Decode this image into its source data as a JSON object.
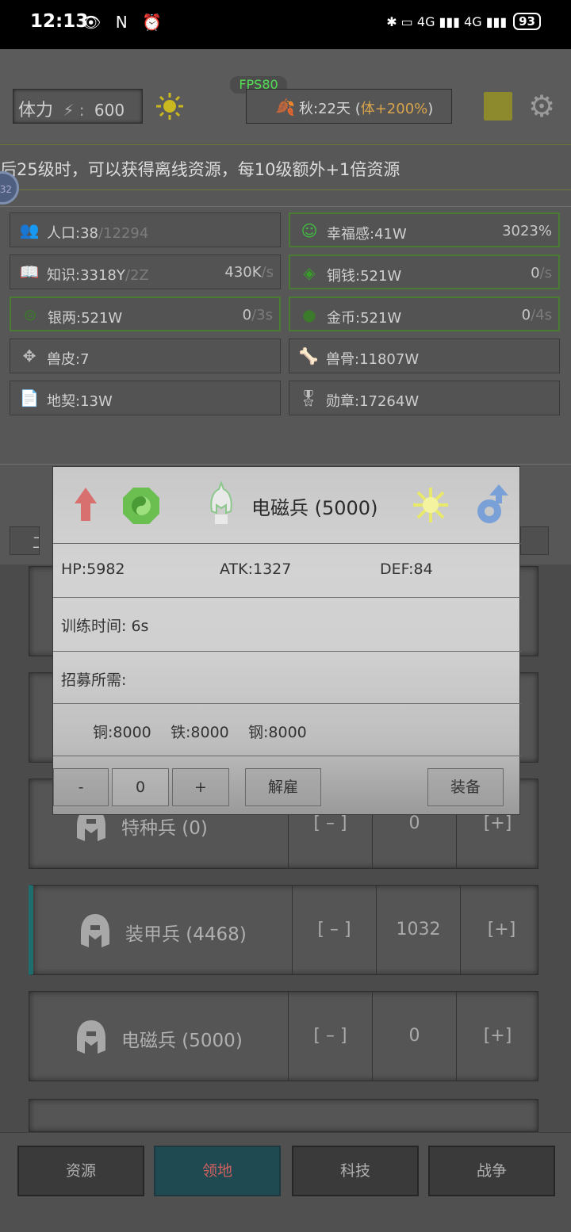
{
  "status_bar": {
    "time": "12:13",
    "icons": "👁 N ⏰",
    "network": "✱ ▭ 4G ▮▮▮ 4G ▮▮▮",
    "battery": "93"
  },
  "top": {
    "stamina_label": "体力",
    "stamina_sep": "⚡ :",
    "stamina_value": "600",
    "fps": "FPS80",
    "season_text": "秋:22天 (",
    "season_bonus": "体+200%",
    "season_close": ")"
  },
  "notice": "后25级时，可以获得离线资源，每10级额外+1倍资源",
  "badge": "32",
  "resources": [
    {
      "icon": "population-icon",
      "glyph": "👥",
      "name": "人口:38",
      "name_dim": "/12294",
      "rate": "",
      "rate_dim": ""
    },
    {
      "icon": "happiness-icon",
      "glyph": "☺",
      "name": "幸福感:41W",
      "name_dim": "",
      "rate": "3023%",
      "rate_dim": ""
    },
    {
      "icon": "knowledge-icon",
      "glyph": "📖",
      "name": "知识:3318Y",
      "name_dim": "/2Z",
      "rate": "430K",
      "rate_dim": "/s"
    },
    {
      "icon": "copper-coin-icon",
      "glyph": "◈",
      "name": "铜钱:521W",
      "name_dim": "",
      "rate": "0",
      "rate_dim": "/s"
    },
    {
      "icon": "silver-icon",
      "glyph": "⊜",
      "name": "银两:521W",
      "name_dim": "",
      "rate": "0",
      "rate_dim": "/3s"
    },
    {
      "icon": "gold-coin-icon",
      "glyph": "●",
      "name": "金币:521W",
      "name_dim": "",
      "rate": "0",
      "rate_dim": "/4s"
    },
    {
      "icon": "beast-hide-icon",
      "glyph": "✥",
      "name": "兽皮:7",
      "name_dim": "",
      "rate": "",
      "rate_dim": ""
    },
    {
      "icon": "beast-bone-icon",
      "glyph": "🦴",
      "name": "兽骨:11807W",
      "name_dim": "",
      "rate": "",
      "rate_dim": ""
    },
    {
      "icon": "land-deed-icon",
      "glyph": "📄",
      "name": "地契:13W",
      "name_dim": "",
      "rate": "",
      "rate_dim": ""
    },
    {
      "icon": "medal-icon",
      "glyph": "🎖",
      "name": "勋章:17264W",
      "name_dim": "",
      "rate": "",
      "rate_dim": ""
    }
  ],
  "tab_partial": "工",
  "units": [
    {
      "name": "特种兵 (0)",
      "minus": "[ – ]",
      "count": "0",
      "plus": "[+]"
    },
    {
      "name": "装甲兵 (4468)",
      "minus": "[ – ]",
      "count": "1032",
      "plus": "[+]"
    },
    {
      "name": "电磁兵 (5000)",
      "minus": "[ – ]",
      "count": "0",
      "plus": "[+]"
    }
  ],
  "dialog": {
    "title": "电磁兵 (5000)",
    "hp": "HP:5982",
    "atk": "ATK:1327",
    "def": "DEF:84",
    "train_time": "训练时间:  6s",
    "recruit_need": "招募所需:",
    "costs": [
      "铜:8000",
      "铁:8000",
      "钢:8000"
    ],
    "minus": "-",
    "qty": "0",
    "plus": "+",
    "dismiss": "解雇",
    "equip": "装备"
  },
  "nav": [
    {
      "label": "资源"
    },
    {
      "label": "领地"
    },
    {
      "label": "科技"
    },
    {
      "label": "战争"
    }
  ],
  "colors": {
    "fps_green": "#52e052",
    "season_bonus": "#d8a44c",
    "active_tab_bg": "#1f4a52",
    "active_tab_text": "#d06060",
    "selected_unit_bar": "#1f6e6e"
  }
}
